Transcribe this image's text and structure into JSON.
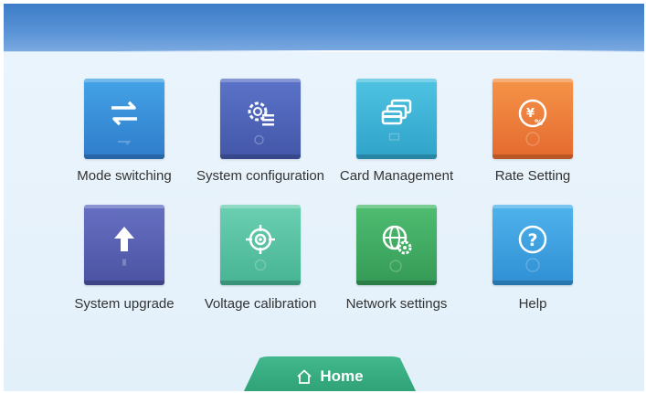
{
  "colors": {
    "header": "#4a86cf",
    "mode_switching": "#3a8fd6",
    "system_configuration": "#4f63b8",
    "card_management": "#3fb5d6",
    "rate_setting": "#ef7b3a",
    "system_upgrade": "#5a63b2",
    "voltage_calibration": "#5cc6a8",
    "network_settings": "#3fae63",
    "help": "#3da0de",
    "home_tab": "#36a87e"
  },
  "menu": [
    {
      "label": "Mode switching",
      "icon": "swap-arrows-icon"
    },
    {
      "label": "System configuration",
      "icon": "gear-list-icon"
    },
    {
      "label": "Card Management",
      "icon": "cards-icon"
    },
    {
      "label": "Rate Setting",
      "icon": "yen-percent-icon"
    },
    {
      "label": "System upgrade",
      "icon": "upload-arrow-icon"
    },
    {
      "label": "Voltage calibration",
      "icon": "crosshair-icon"
    },
    {
      "label": "Network settings",
      "icon": "globe-gear-icon"
    },
    {
      "label": "Help",
      "icon": "question-icon"
    }
  ],
  "bottom_nav": {
    "home_label": "Home",
    "home_icon": "home-icon"
  }
}
